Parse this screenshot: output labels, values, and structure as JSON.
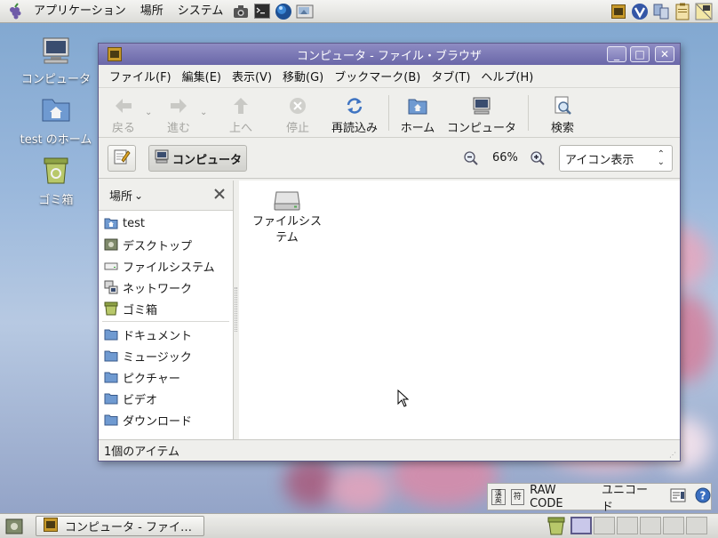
{
  "top_panel": {
    "menus": [
      "アプリケーション",
      "場所",
      "システム"
    ],
    "launchers": [
      "camera-icon",
      "terminal-icon",
      "web-browser-icon",
      "screenshot-icon"
    ],
    "tray": [
      "notes-icon",
      "update-icon",
      "network-icon",
      "clipboard-icon",
      "display-icon"
    ]
  },
  "desktop": {
    "icons": [
      {
        "label": "コンピュータ",
        "icon": "computer-icon"
      },
      {
        "label": "test のホーム",
        "icon": "home-folder-icon"
      },
      {
        "label": "ゴミ箱",
        "icon": "trash-icon"
      }
    ]
  },
  "window": {
    "title": "コンピュータ - ファイル・ブラウザ",
    "controls": {
      "minimize": "_",
      "maximize": "□",
      "close": "✕"
    },
    "menubar": [
      "ファイル(F)",
      "編集(E)",
      "表示(V)",
      "移動(G)",
      "ブックマーク(B)",
      "タブ(T)",
      "ヘルプ(H)"
    ],
    "toolbar": {
      "back": "戻る",
      "forward": "進む",
      "up": "上へ",
      "stop": "停止",
      "reload": "再読込み",
      "home": "ホーム",
      "computer": "コンピュータ",
      "search": "検索"
    },
    "location": {
      "path_button": "コンピュータ",
      "zoom": "66%",
      "view_mode": "アイコン表示"
    },
    "sidebar": {
      "header": "場所",
      "places": [
        {
          "label": "test",
          "icon": "home-folder-icon"
        },
        {
          "label": "デスクトップ",
          "icon": "desktop-icon"
        },
        {
          "label": "ファイルシステム",
          "icon": "drive-icon"
        },
        {
          "label": "ネットワーク",
          "icon": "network-icon"
        },
        {
          "label": "ゴミ箱",
          "icon": "trash-icon"
        }
      ],
      "bookmarks": [
        {
          "label": "ドキュメント",
          "icon": "folder-icon"
        },
        {
          "label": "ミュージック",
          "icon": "folder-icon"
        },
        {
          "label": "ピクチャー",
          "icon": "folder-icon"
        },
        {
          "label": "ビデオ",
          "icon": "folder-icon"
        },
        {
          "label": "ダウンロード",
          "icon": "folder-icon"
        }
      ]
    },
    "files": [
      {
        "label_line1": "ファイルシス",
        "label_line2": "テム",
        "icon": "drive-icon"
      }
    ],
    "status": "1個のアイテム"
  },
  "ime": {
    "mode": "RAW CODE",
    "input": "ユニコード"
  },
  "taskbar": {
    "task_label": "コンピュータ - ファイ…"
  },
  "colors": {
    "titlebar": "#7a77b6",
    "panel": "#e8e8e5",
    "folder": "#6f9ad1"
  }
}
